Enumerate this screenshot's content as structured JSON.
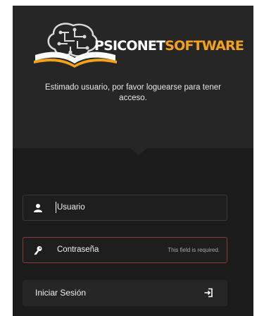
{
  "header": {
    "brand_part1": "PSICONET",
    "brand_part2": "SOFTWARE",
    "subtitle": "Estimado usuario, por favor loguearse para tener acceso.",
    "colors": {
      "accent": "#f5a21b",
      "background": "#1b1b1b",
      "header_bg": "#262626"
    }
  },
  "form": {
    "username": {
      "label": "Usuario",
      "icon": "user-icon"
    },
    "password": {
      "label": "Contraseña",
      "icon": "key-icon",
      "error": "This field is required."
    },
    "submit": {
      "label": "Iniciar Sesión",
      "icon": "sign-in-icon"
    }
  }
}
